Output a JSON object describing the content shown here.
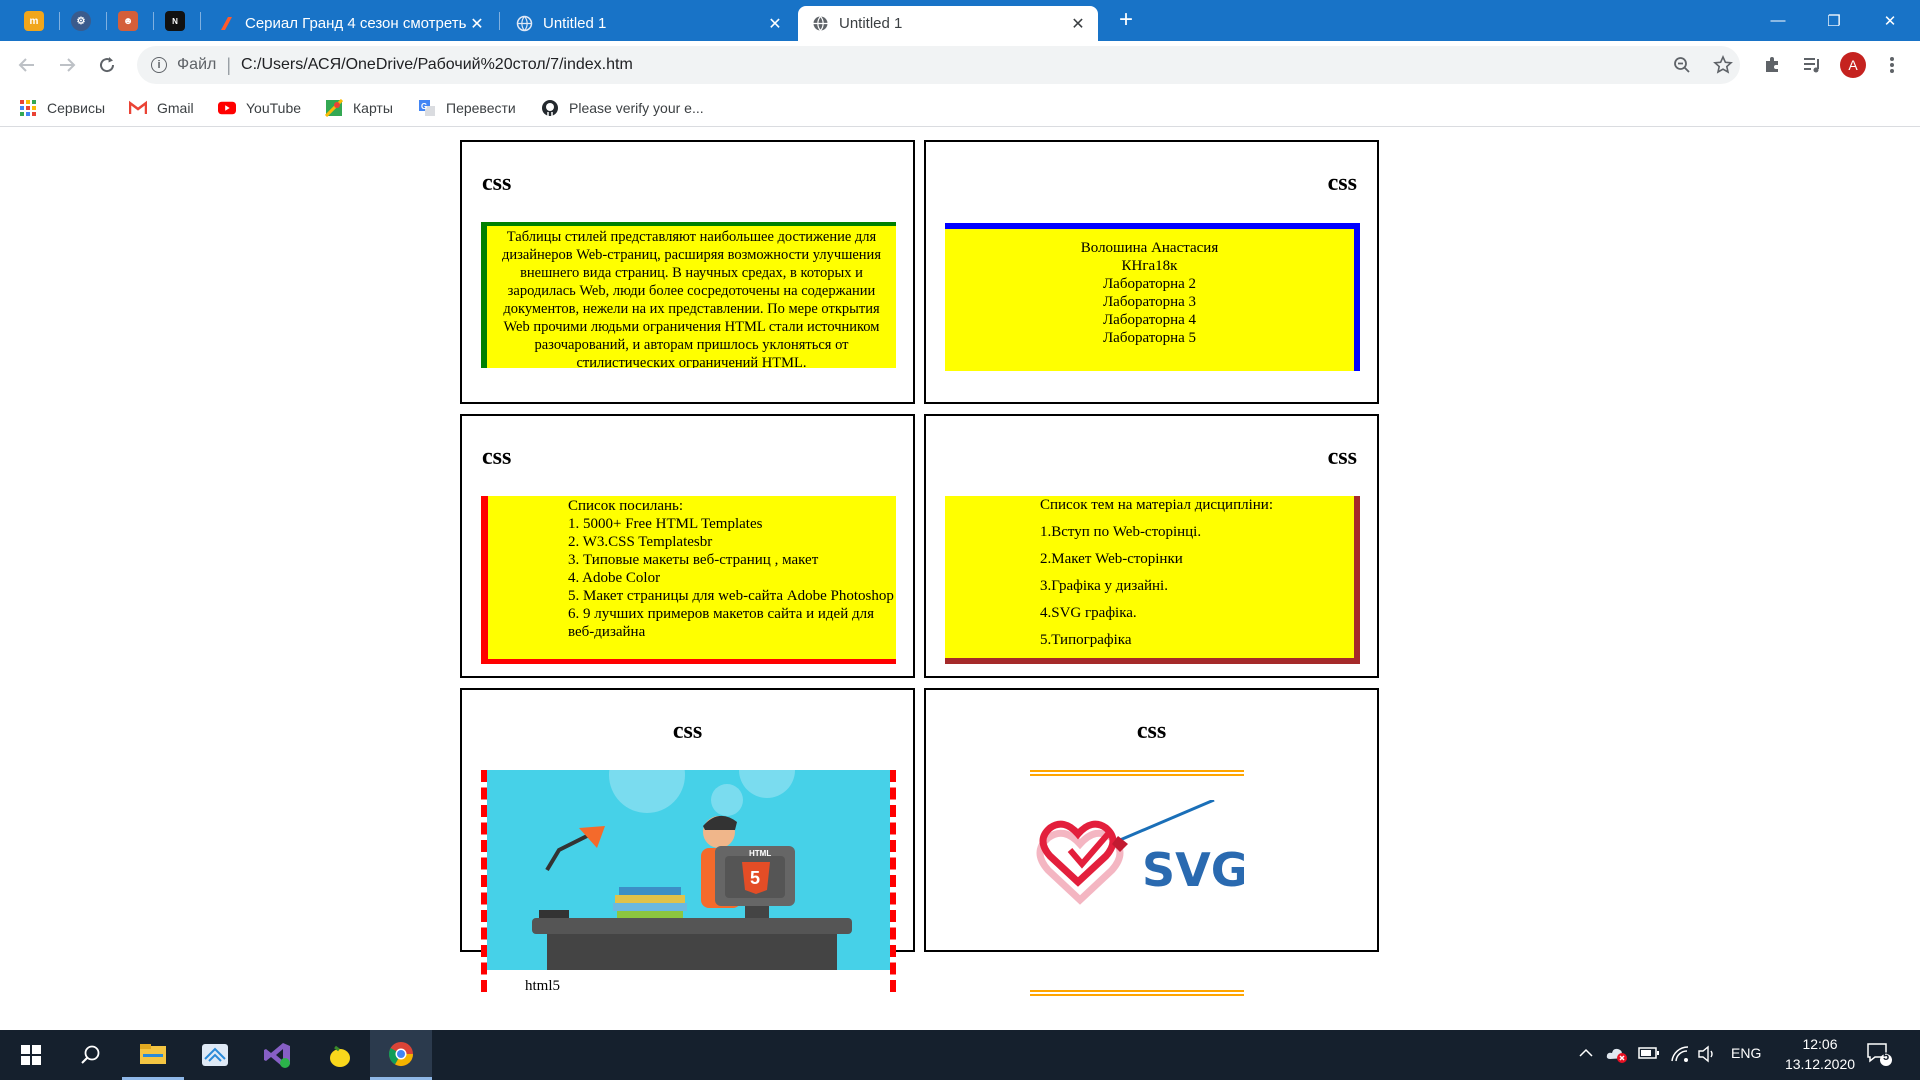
{
  "browser": {
    "pinned_tabs": [
      {
        "icon": "mn-app-icon",
        "color": "#f1a61b",
        "text": "m"
      },
      {
        "icon": "globe-settings-icon",
        "color": "#3a5b8c",
        "text": "⚙"
      },
      {
        "icon": "mascot-icon",
        "color": "#d45f3a",
        "text": "☻"
      },
      {
        "icon": "notion-icon",
        "color": "#111111",
        "text": "N"
      }
    ],
    "tabs": [
      {
        "title": "Сериал Гранд 4 сезон смотреть",
        "close": "✕"
      },
      {
        "title": "Untitled 1",
        "close": "✕"
      },
      {
        "title": "Untitled 1",
        "close": "✕"
      }
    ],
    "new_tab": "+",
    "window_controls": {
      "minimize": "—",
      "restore": "❐",
      "close": "✕"
    },
    "address": {
      "scheme": "Файл",
      "separator": "|",
      "url": "C:/Users/АСЯ/OneDrive/Рабочий%20стол/7/index.htm"
    },
    "avatar_letter": "A",
    "bookmarks": [
      {
        "label": "Сервисы",
        "icon": "apps-grid-icon"
      },
      {
        "label": "Gmail",
        "icon": "gmail-icon"
      },
      {
        "label": "YouTube",
        "icon": "youtube-icon"
      },
      {
        "label": "Карты",
        "icon": "maps-icon"
      },
      {
        "label": "Перевести",
        "icon": "translate-icon"
      },
      {
        "label": "Please verify your e...",
        "icon": "github-icon"
      }
    ]
  },
  "cards": [
    {
      "heading": "css",
      "text": "Таблицы стилей представляют наибольшее достижение для дизайнеров Web-страниц, расширяя возможности улучшения внешнего вида страниц. В научных средах, в которых и зародилась Web, люди более сосредоточены на содержании документов, нежели на их представлении. По мере открытия Web прочими людьми ограничения HTML стали источником разочарований, и авторам пришлось уклоняться от стилистических ограничений HTML."
    },
    {
      "heading": "css",
      "lines": [
        "Волошина Анастасия",
        "КНга18к",
        "Лабораторна 2",
        "Лабораторна 3",
        "Лабораторна 4",
        "Лабораторна 5"
      ]
    },
    {
      "heading": "css",
      "list_title": "Список посилань:",
      "links": [
        "1. 5000+ Free HTML Templates",
        "2. W3.CSS Templatesbr",
        "3. Типовые макеты веб-страниц , макет",
        "4. Adobe Color",
        "5. Макет страницы для web-сайта Adobe Photoshop",
        "6. 9 лучших примеров макетов сайта и идей для веб-дизайна"
      ]
    },
    {
      "heading": "css",
      "list_title": "Список тем на матеріал дисципліни:",
      "topics": [
        "1.Вступ по Web-сторінці.",
        "2.Макет Web-сторінки",
        "3.Графіка у дизайні.",
        "4.SVG графіка.",
        "5.Типографіка"
      ]
    },
    {
      "heading": "css",
      "image_label": "HTML",
      "caption": "html5"
    },
    {
      "heading": "css",
      "svg_logo_text": "SVG"
    }
  ],
  "taskbar": {
    "apps": [
      "windows-start-icon",
      "search-icon",
      "file-explorer-icon",
      "network-app-icon",
      "visual-studio-icon",
      "lemon-app-icon",
      "chrome-icon"
    ],
    "tray": {
      "language": "ENG",
      "time": "12:06",
      "date": "13.12.2020",
      "notifications": "5"
    }
  },
  "colors": {
    "tabstrip": "#1873c7",
    "yellow": "#ffff00",
    "green": "#008000",
    "blue": "#0000ff",
    "red": "#ff0000",
    "brown": "#a52a2a",
    "orange": "#ffa500",
    "taskbar": "#15202d"
  }
}
